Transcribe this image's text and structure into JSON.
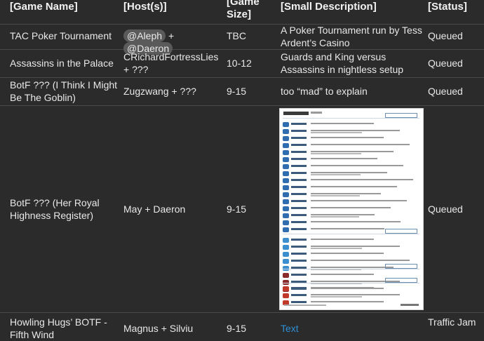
{
  "headers": {
    "game_name": "[Game Name]",
    "host": "[Host(s)]",
    "game_size": "[Game Size]",
    "description": "[Small Description]",
    "status": "[Status]"
  },
  "rows": [
    {
      "game_name": "TAC Poker Tournament",
      "host_mention_1": "@Aleph",
      "host_plus": "+",
      "host_mention_2": "@Daeron",
      "game_size": "TBC",
      "description": "A Poker Tournament run by Tess Ardent’s Casino",
      "status": "Queued"
    },
    {
      "game_name": "Assassins in the Palace",
      "host": "CRichardFortressLies + ???",
      "game_size": "10-12",
      "description": "Guards and King versus Assassins in nightless setup",
      "status": "Queued"
    },
    {
      "game_name": "BotF ??? (I Think I Might Be The Goblin)",
      "host": "Zugzwang + ???",
      "game_size": "9-15",
      "description": "too “mad” to explain",
      "status": "Queued"
    },
    {
      "game_name": "BotF ??? (Her Royal Highness Register)",
      "host": "May + Daeron",
      "game_size": "9-15",
      "status": "Queued"
    },
    {
      "game_name": "Howling Hugs’ BOTF - Fifth Wind",
      "host": "Magnus + Silviu",
      "game_size": "9-15",
      "description_link": "Text",
      "status": "Traffic Jam"
    }
  ],
  "doc_icon_colors": [
    "#2f6db0",
    "#3c8fcf",
    "#8a2b2b",
    "#c0392b"
  ]
}
